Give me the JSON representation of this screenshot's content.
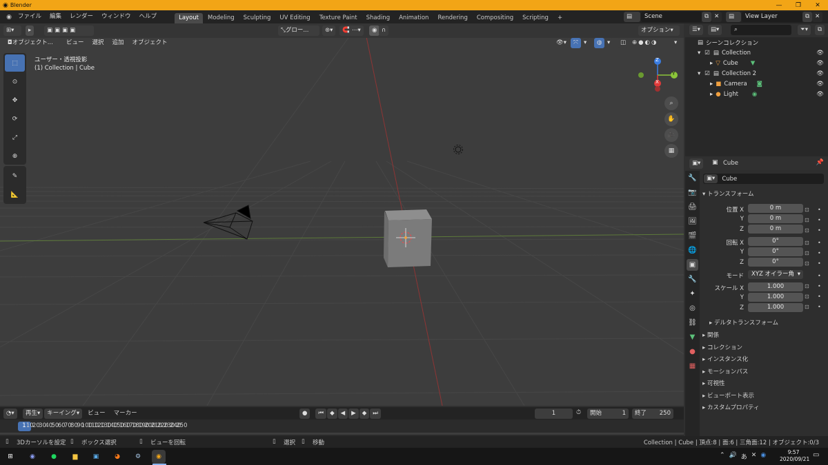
{
  "window": {
    "title": "Blender"
  },
  "menus": [
    "ファイル",
    "編集",
    "レンダー",
    "ウィンドウ",
    "ヘルプ"
  ],
  "workspaces": [
    "Layout",
    "Modeling",
    "Sculpting",
    "UV Editing",
    "Texture Paint",
    "Shading",
    "Animation",
    "Rendering",
    "Compositing",
    "Scripting",
    "+"
  ],
  "active_workspace": "Layout",
  "scene": "Scene",
  "view_layer": "View Layer",
  "viewport": {
    "transform_orientation": "グロー...",
    "options_label": "オプション",
    "mode_label": "オブジェクト...",
    "header_menus": [
      "ビュー",
      "選択",
      "追加",
      "オブジェクト"
    ],
    "view_name": "ユーザー・透視投影",
    "view_context": "(1) Collection | Cube",
    "gizmo_axes": {
      "z": "Z",
      "y": "Y",
      "x": "X"
    }
  },
  "outliner": {
    "root": "シーンコレクション",
    "items": [
      {
        "name": "Collection"
      },
      {
        "name": "Cube"
      },
      {
        "name": "Collection 2"
      },
      {
        "name": "Camera"
      },
      {
        "name": "Light"
      }
    ]
  },
  "properties": {
    "object_name_header": "Cube",
    "object_name_field": "Cube",
    "transform_title": "トランスフォーム",
    "location_label": "位置 X",
    "location": [
      "0 m",
      "0 m",
      "0 m"
    ],
    "rotation_label": "回転 X",
    "rotation": [
      "0°",
      "0°",
      "0°"
    ],
    "mode_label": "モード",
    "mode_value": "XYZ オイラー角",
    "scale_label": "スケール X",
    "scale": [
      "1.000",
      "1.000",
      "1.000"
    ],
    "axis_y": "Y",
    "axis_z": "Z",
    "delta_label": "デルタトランスフォーム",
    "sections": [
      "関係",
      "コレクション",
      "インスタンス化",
      "モーションパス",
      "可視性",
      "ビューポート表示",
      "カスタムプロパティ"
    ]
  },
  "timeline": {
    "menus": [
      "再生",
      "キーイング",
      "ビュー",
      "マーカー"
    ],
    "current_frame": "1",
    "start_label": "開始",
    "start": "1",
    "end_label": "終了",
    "end": "250",
    "ticks": [
      "1",
      "10",
      "20",
      "30",
      "40",
      "50",
      "60",
      "70",
      "80",
      "90",
      "100",
      "110",
      "120",
      "130",
      "140",
      "150",
      "160",
      "170",
      "180",
      "190",
      "200",
      "210",
      "220",
      "230",
      "240",
      "250"
    ]
  },
  "statusbar": {
    "hints": [
      "3Dカーソルを設定",
      "ボックス選択",
      "ビューを回転",
      "選択",
      "移動"
    ],
    "info": "Collection | Cube | 頂点:8 | 面:6 | 三角面:12 | オブジェクト:0/3"
  },
  "taskbar": {
    "time": "9:57",
    "date": "2020/09/21"
  },
  "colors": {
    "title_bar": "#f2a516",
    "active_tool": "#4772b3",
    "x_axis": "#e23a3a",
    "y_axis": "#8bc53a",
    "z_axis": "#3a7de2"
  }
}
